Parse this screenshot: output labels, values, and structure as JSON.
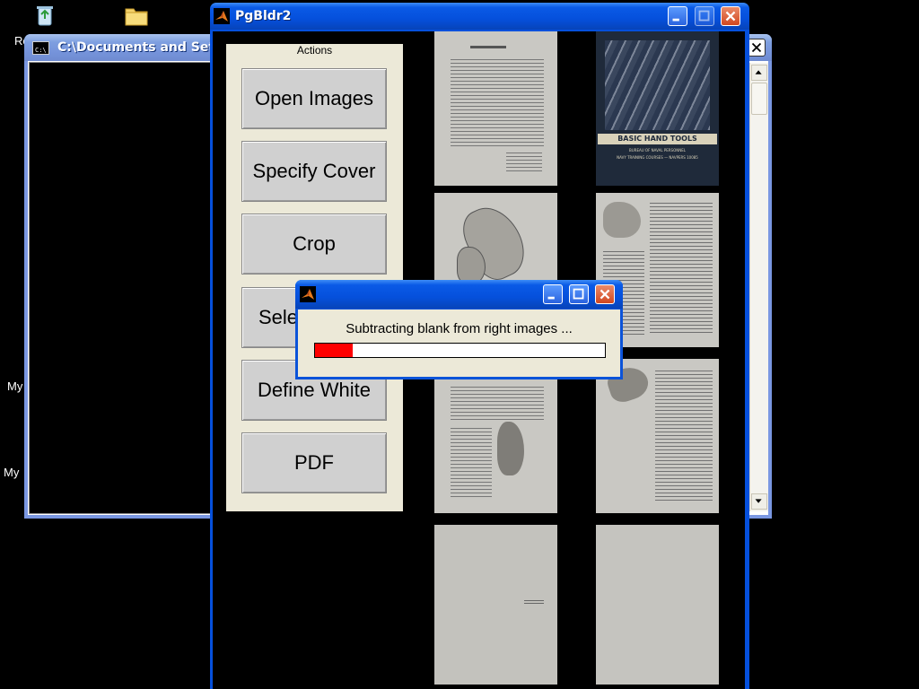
{
  "desktop": {
    "labels": [
      "Re",
      "My",
      "My"
    ]
  },
  "cmd_window": {
    "title": "C:\\Documents and Setti"
  },
  "pg_window": {
    "title": "PgBldr2",
    "actions": {
      "title": "Actions",
      "buttons": [
        "Open Images",
        "Specify Cover",
        "Crop",
        "Select",
        "Define White",
        "PDF"
      ]
    },
    "thumbnails": [
      {
        "name": "page-1-text",
        "kind": "text"
      },
      {
        "name": "page-cover",
        "kind": "cover",
        "cover_text": [
          "BASIC HAND TOOLS",
          "BUREAU OF NAVAL PERSONNEL",
          "NAVY TRAINING COURSES — NAVPERS 10085"
        ]
      },
      {
        "name": "page-2-illustration",
        "kind": "illustration"
      },
      {
        "name": "page-3-text",
        "kind": "text"
      },
      {
        "name": "page-4-figure",
        "kind": "figure"
      },
      {
        "name": "page-5-text",
        "kind": "text"
      },
      {
        "name": "page-6-blank",
        "kind": "blank"
      },
      {
        "name": "page-7-blank",
        "kind": "blank"
      }
    ]
  },
  "progress_dialog": {
    "message": "Subtracting blank from right images ...",
    "progress": 0.13,
    "fill_color": "#ff0000"
  },
  "colors": {
    "xp_title_active": "#0550dc",
    "panel": "#ece9d8"
  }
}
